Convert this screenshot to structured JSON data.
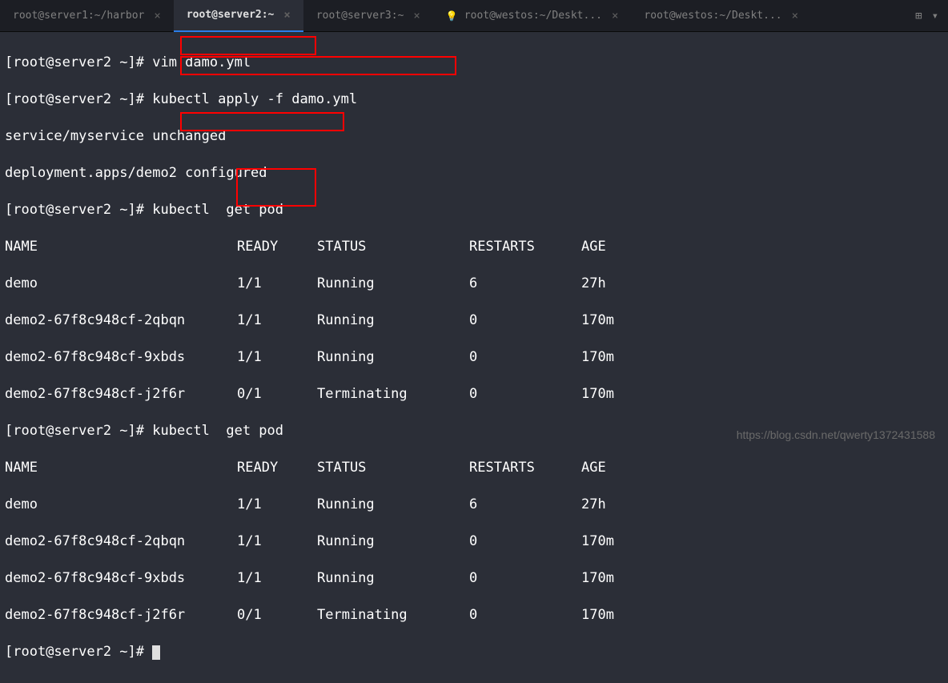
{
  "tabs": [
    {
      "label": "root@server1:~/harbor",
      "active": false,
      "close": "×"
    },
    {
      "label": "root@server2:~",
      "active": true,
      "close": "×"
    },
    {
      "label": "root@server3:~",
      "active": false,
      "close": "×"
    },
    {
      "label": "root@westos:~/Deskt...",
      "active": false,
      "close": "×",
      "icon": "💡"
    },
    {
      "label": "root@westos:~/Deskt...",
      "active": false,
      "close": "×"
    }
  ],
  "tabRight": {
    "icon1": "⊞",
    "icon2": "▾"
  },
  "prompt": "[root@server2 ~]# ",
  "commands": {
    "c1": "vim damo.yml",
    "c2": "kubectl apply -f damo.yml",
    "c3": "kubectl  get pod",
    "c4": "kubectl  get pod"
  },
  "output": {
    "apply1": "service/myservice unchanged",
    "apply2": "deployment.apps/demo2 configured"
  },
  "table1": {
    "header": {
      "name": "NAME",
      "ready": "READY",
      "status": "STATUS",
      "restarts": "RESTARTS",
      "age": "AGE"
    },
    "rows": [
      {
        "name": "demo",
        "ready": "1/1",
        "status": "Running",
        "restarts": "6",
        "age": "27h"
      },
      {
        "name": "demo2-67f8c948cf-2qbqn",
        "ready": "1/1",
        "status": "Running",
        "restarts": "0",
        "age": "170m"
      },
      {
        "name": "demo2-67f8c948cf-9xbds",
        "ready": "1/1",
        "status": "Running",
        "restarts": "0",
        "age": "170m"
      },
      {
        "name": "demo2-67f8c948cf-j2f6r",
        "ready": "0/1",
        "status": "Terminating",
        "restarts": "0",
        "age": "170m"
      }
    ]
  },
  "table2": {
    "header": {
      "name": "NAME",
      "ready": "READY",
      "status": "STATUS",
      "restarts": "RESTARTS",
      "age": "AGE"
    },
    "rows": [
      {
        "name": "demo",
        "ready": "1/1",
        "status": "Running",
        "restarts": "6",
        "age": "27h"
      },
      {
        "name": "demo2-67f8c948cf-2qbqn",
        "ready": "1/1",
        "status": "Running",
        "restarts": "0",
        "age": "170m"
      },
      {
        "name": "demo2-67f8c948cf-9xbds",
        "ready": "1/1",
        "status": "Running",
        "restarts": "0",
        "age": "170m"
      },
      {
        "name": "demo2-67f8c948cf-j2f6r",
        "ready": "0/1",
        "status": "Terminating",
        "restarts": "0",
        "age": "170m"
      }
    ]
  },
  "watermark": "https://blog.csdn.net/qwerty1372431588"
}
